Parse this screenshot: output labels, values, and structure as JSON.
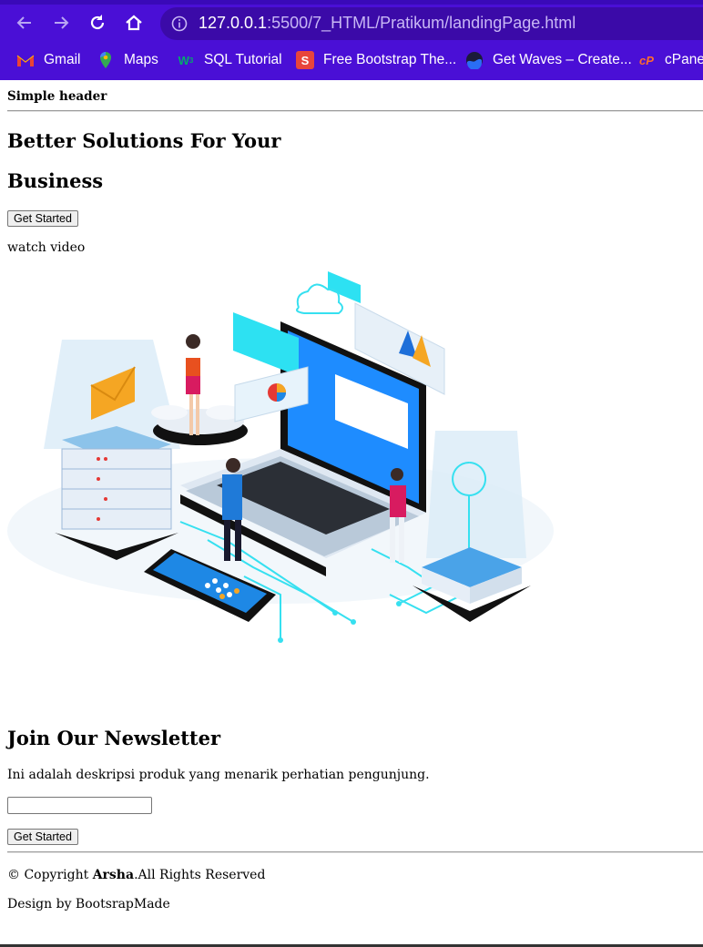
{
  "browser": {
    "url_host": "127.0.0.1",
    "url_rest": ":5500/7_HTML/Pratikum/landingPage.html",
    "bookmarks": [
      {
        "label": "Gmail",
        "icon": "gmail-icon"
      },
      {
        "label": "Maps",
        "icon": "maps-icon"
      },
      {
        "label": "SQL Tutorial",
        "icon": "w3schools-icon"
      },
      {
        "label": "Free Bootstrap The...",
        "icon": "bootstrap-s-icon"
      },
      {
        "label": "Get Waves – Create...",
        "icon": "waves-icon"
      },
      {
        "label": "cPanel",
        "icon": "cpanel-icon"
      }
    ],
    "colors": {
      "toolbar": "#4a0fd6",
      "urlbar": "#3b0aa8"
    }
  },
  "page": {
    "header": "Simple header",
    "hero_line1": "Better Solutions For Your",
    "hero_line2": "Business",
    "cta_label": "Get Started",
    "watch_video": "watch video",
    "newsletter_title": "Join Our Newsletter",
    "newsletter_desc": "Ini adalah deskripsi produk yang menarik perhatian pengunjung.",
    "email_value": "",
    "submit_label": "Get Started",
    "copyright_prefix": "© Copyright ",
    "copyright_brand": "Arsha",
    "copyright_suffix": ".All Rights Reserved",
    "design_credit": "Design by BootsrapMade"
  }
}
